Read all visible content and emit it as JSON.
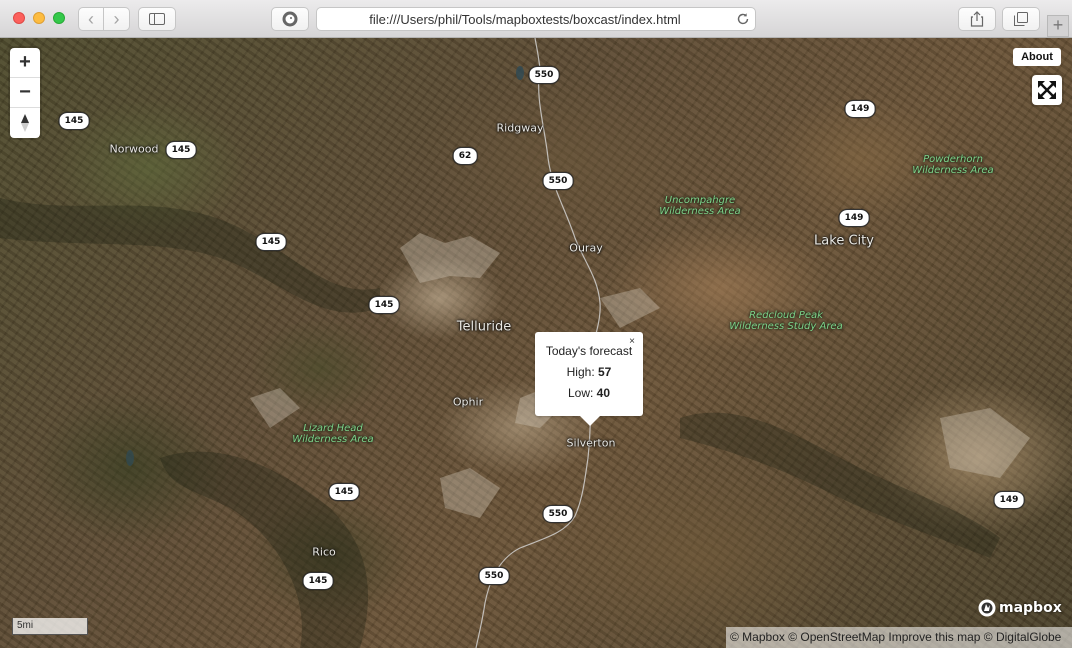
{
  "browser": {
    "url": "file:///Users/phil/Tools/mapboxtests/boxcast/index.html",
    "new_tab_label": "+"
  },
  "map": {
    "places": [
      {
        "name": "Ridgway",
        "kind": "town"
      },
      {
        "name": "Norwood",
        "kind": "town"
      },
      {
        "name": "Ouray",
        "kind": "town"
      },
      {
        "name": "Lake City",
        "kind": "city"
      },
      {
        "name": "Telluride",
        "kind": "city"
      },
      {
        "name": "Ophir",
        "kind": "town"
      },
      {
        "name": "Silverton",
        "kind": "town"
      },
      {
        "name": "Rico",
        "kind": "town"
      }
    ],
    "wilderness": [
      {
        "line1": "Uncompahgre",
        "line2": "Wilderness Area"
      },
      {
        "line1": "Powderhorn",
        "line2": "Wilderness Area"
      },
      {
        "line1": "Redcloud Peak",
        "line2": "Wilderness Study Area"
      },
      {
        "line1": "Lizard Head",
        "line2": "Wilderness Area"
      }
    ],
    "shields": [
      "550",
      "145",
      "145",
      "62",
      "550",
      "145",
      "149",
      "149",
      "145",
      "550",
      "145",
      "149",
      "145",
      "550"
    ],
    "controls": {
      "zoom_in": "+",
      "zoom_out": "−",
      "compass": "▲"
    },
    "about_label": "About",
    "scale_label": "5mi",
    "attribution": "© Mapbox © OpenStreetMap Improve this map © DigitalGlobe",
    "logo_text": "mapbox",
    "popup": {
      "close": "×",
      "title": "Today's forecast",
      "high_label": "High:",
      "high_value": "57",
      "low_label": "Low:",
      "low_value": "40"
    }
  }
}
